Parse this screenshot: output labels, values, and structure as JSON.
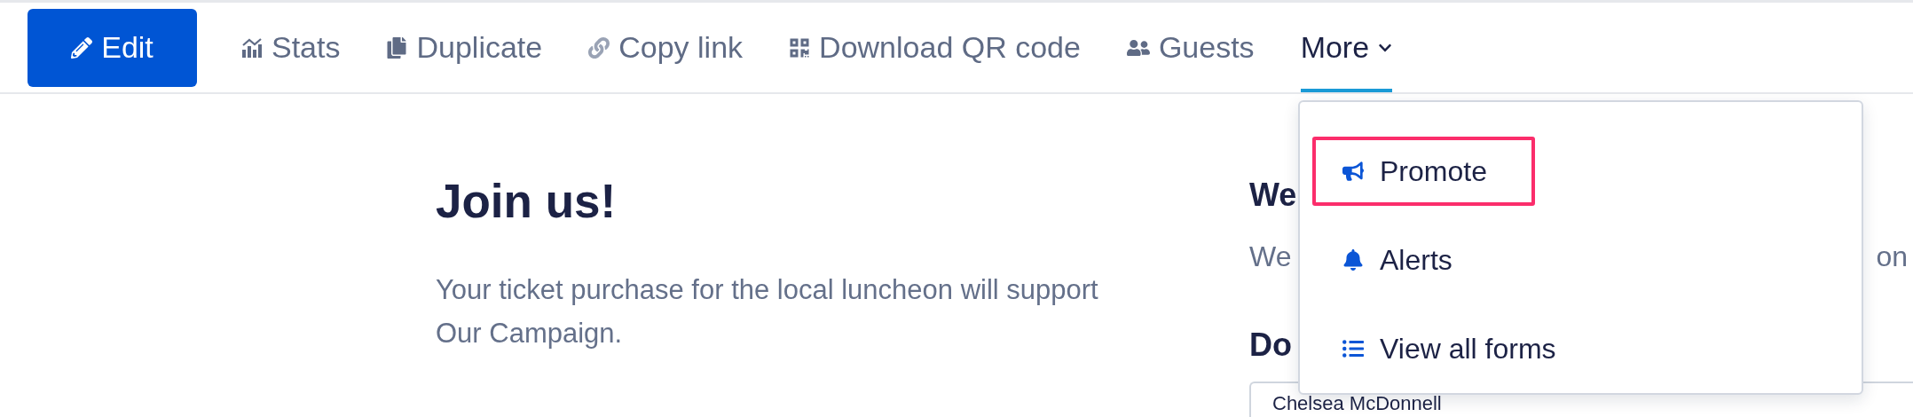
{
  "toolbar": {
    "edit_button": "Edit",
    "tabs": [
      {
        "label": "Stats",
        "kind": "action",
        "selected": false
      },
      {
        "label": "Duplicate",
        "kind": "action",
        "selected": false
      },
      {
        "label": "Copy link",
        "kind": "action",
        "selected": false
      },
      {
        "label": "Download QR code",
        "kind": "action",
        "selected": false
      },
      {
        "label": "Guests",
        "kind": "action",
        "selected": false
      },
      {
        "label": "More",
        "kind": "menu",
        "selected": true
      }
    ]
  },
  "dropdown": {
    "items": [
      {
        "label": "Promote",
        "highlighted": true
      },
      {
        "label": "Alerts",
        "highlighted": false
      },
      {
        "label": "View all forms",
        "highlighted": false
      }
    ]
  },
  "content": {
    "title": "Join us!",
    "description": "Your ticket purchase for the local luncheon will support Our Campaign."
  },
  "side": {
    "heading_1": "We",
    "text_start": "We",
    "text_end": "on",
    "heading_2": "Do",
    "field_value": "Chelsea McDonnell"
  }
}
